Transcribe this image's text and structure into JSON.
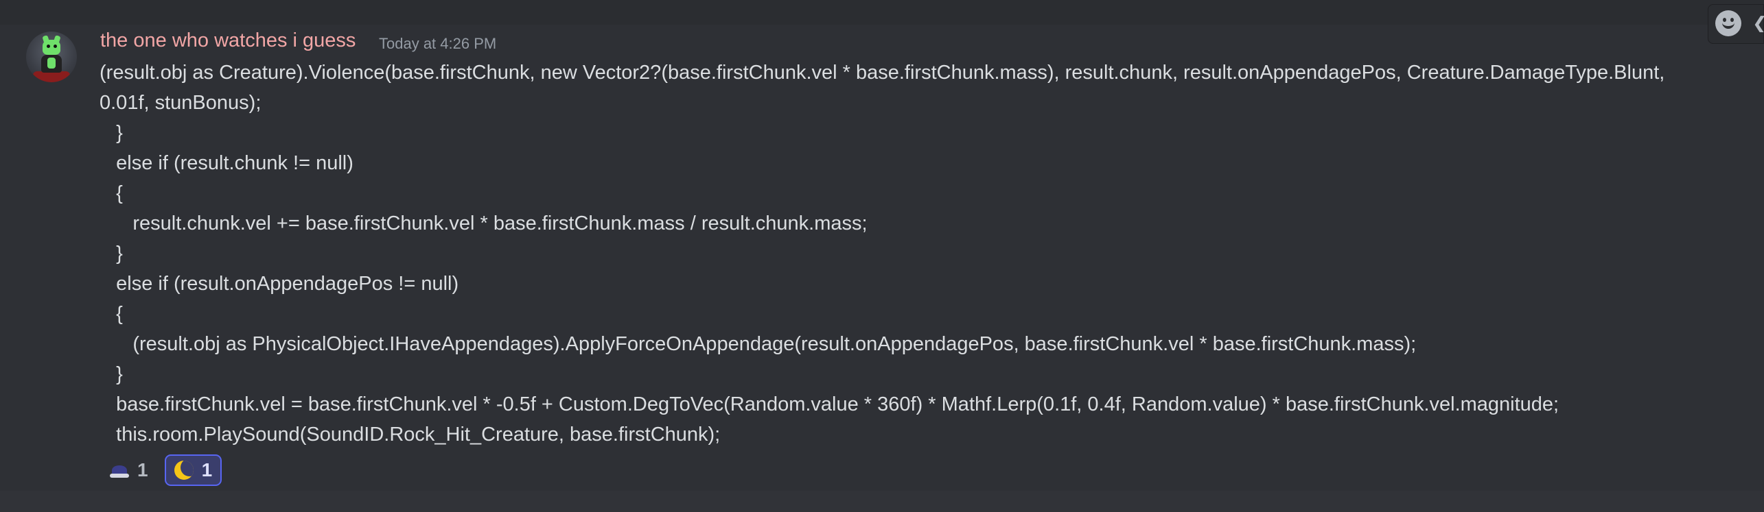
{
  "message": {
    "author": "the one who watches i guess",
    "timestamp": "Today at 4:26 PM",
    "avatar_icon": "robot-figure-avatar",
    "content_lines": [
      "(result.obj as Creature).Violence(base.firstChunk, new Vector2?(base.firstChunk.vel * base.firstChunk.mass), result.chunk, result.onAppendagePos, Creature.DamageType.Blunt,",
      "0.01f, stunBonus);",
      "   }",
      "   else if (result.chunk != null)",
      "   {",
      "      result.chunk.vel += base.firstChunk.vel * base.firstChunk.mass / result.chunk.mass;",
      "   }",
      "   else if (result.onAppendagePos != null)",
      "   {",
      "      (result.obj as PhysicalObject.IHaveAppendages).ApplyForceOnAppendage(result.onAppendagePos, base.firstChunk.vel * base.firstChunk.mass);",
      "   }",
      "   base.firstChunk.vel = base.firstChunk.vel * -0.5f + Custom.DegToVec(Random.value * 360f) * Mathf.Lerp(0.1f, 0.4f, Random.value) * base.firstChunk.vel.magnitude;",
      "   this.room.PlaySound(SoundID.Rock_Hit_Creature, base.firstChunk);"
    ]
  },
  "reactions": [
    {
      "emoji_icon": "wizard-hat-icon",
      "count": "1",
      "active": false
    },
    {
      "emoji_icon": "crescent-moon-icon",
      "count": "1",
      "active": true
    }
  ],
  "toolbar": {
    "add_reaction_icon": "smile-icon",
    "more_icon": "more-icon"
  },
  "colors": {
    "background": "#313338",
    "message_hover": "#2e3035",
    "username": "#f2a6a6",
    "timestamp": "#949ba4",
    "text": "#dbdee1",
    "reaction_active_border": "#5865f2",
    "reaction_active_bg": "#3a3e6c",
    "moon": "#f5c518"
  }
}
